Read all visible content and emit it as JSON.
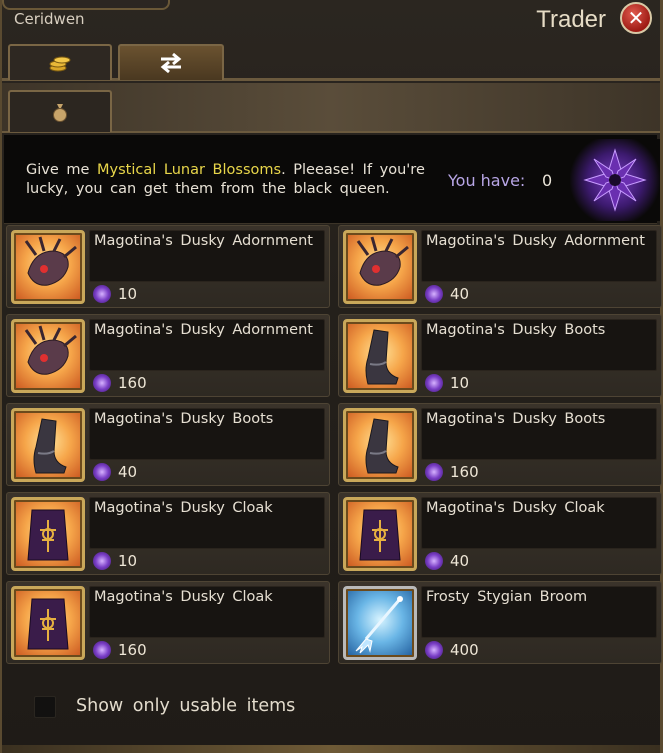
{
  "window": {
    "location": "Ceridwen",
    "title": "Trader",
    "close_symbol": "✕"
  },
  "tabs": [
    {
      "icon": "gold-coins-icon",
      "active": false
    },
    {
      "icon": "swap-arrows-icon",
      "active": true
    }
  ],
  "subtabs": [
    {
      "icon": "money-bag-icon"
    }
  ],
  "quest": {
    "text_before": "Give me ",
    "highlight": "Mystical Lunar Blossoms",
    "text_after": ". Pleease! If you're lucky, you can get them from the black queen.",
    "you_have_label": "You have:",
    "you_have_value": "0",
    "currency_icon": "lunar-blossom-icon"
  },
  "items": [
    {
      "name": "Magotina's Dusky Adornment",
      "cost": "10",
      "icon": "dusky-adornment-icon"
    },
    {
      "name": "Magotina's Dusky Adornment",
      "cost": "40",
      "icon": "dusky-adornment-icon"
    },
    {
      "name": "Magotina's Dusky Adornment",
      "cost": "160",
      "icon": "dusky-adornment-icon"
    },
    {
      "name": "Magotina's Dusky Boots",
      "cost": "10",
      "icon": "dusky-boots-icon"
    },
    {
      "name": "Magotina's Dusky Boots",
      "cost": "40",
      "icon": "dusky-boots-icon"
    },
    {
      "name": "Magotina's Dusky Boots",
      "cost": "160",
      "icon": "dusky-boots-icon"
    },
    {
      "name": "Magotina's Dusky Cloak",
      "cost": "10",
      "icon": "dusky-cloak-icon"
    },
    {
      "name": "Magotina's Dusky Cloak",
      "cost": "40",
      "icon": "dusky-cloak-icon"
    },
    {
      "name": "Magotina's Dusky Cloak",
      "cost": "160",
      "icon": "dusky-cloak-icon"
    },
    {
      "name": "Frosty Stygian Broom",
      "cost": "400",
      "icon": "stygian-broom-icon"
    }
  ],
  "footer": {
    "checkbox_label": "Show only usable items",
    "checked": false
  },
  "colors": {
    "highlight": "#e8d64a",
    "you_have": "#b8a6e6",
    "frame": "#6b5a3e"
  }
}
